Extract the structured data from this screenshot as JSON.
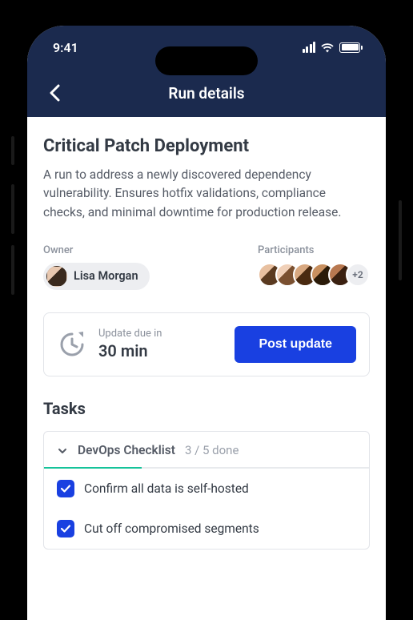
{
  "status": {
    "time": "9:41"
  },
  "nav": {
    "title": "Run details"
  },
  "run": {
    "title": "Critical Patch Deployment",
    "description": "A run to address a newly discovered dependency vulnerability. Ensures hotfix validations, compliance checks, and minimal downtime for production release.",
    "owner_label": "Owner",
    "owner_name": "Lisa Morgan",
    "participants_label": "Participants",
    "participants_overflow": "+2"
  },
  "update": {
    "label": "Update due in",
    "time": "30 min",
    "button": "Post update"
  },
  "tasks": {
    "heading": "Tasks",
    "section_title": "DevOps Checklist",
    "progress_text": "3 / 5 done",
    "items": [
      {
        "label": "Confirm all data is self-hosted",
        "checked": true
      },
      {
        "label": "Cut off compromised segments",
        "checked": true
      }
    ]
  }
}
